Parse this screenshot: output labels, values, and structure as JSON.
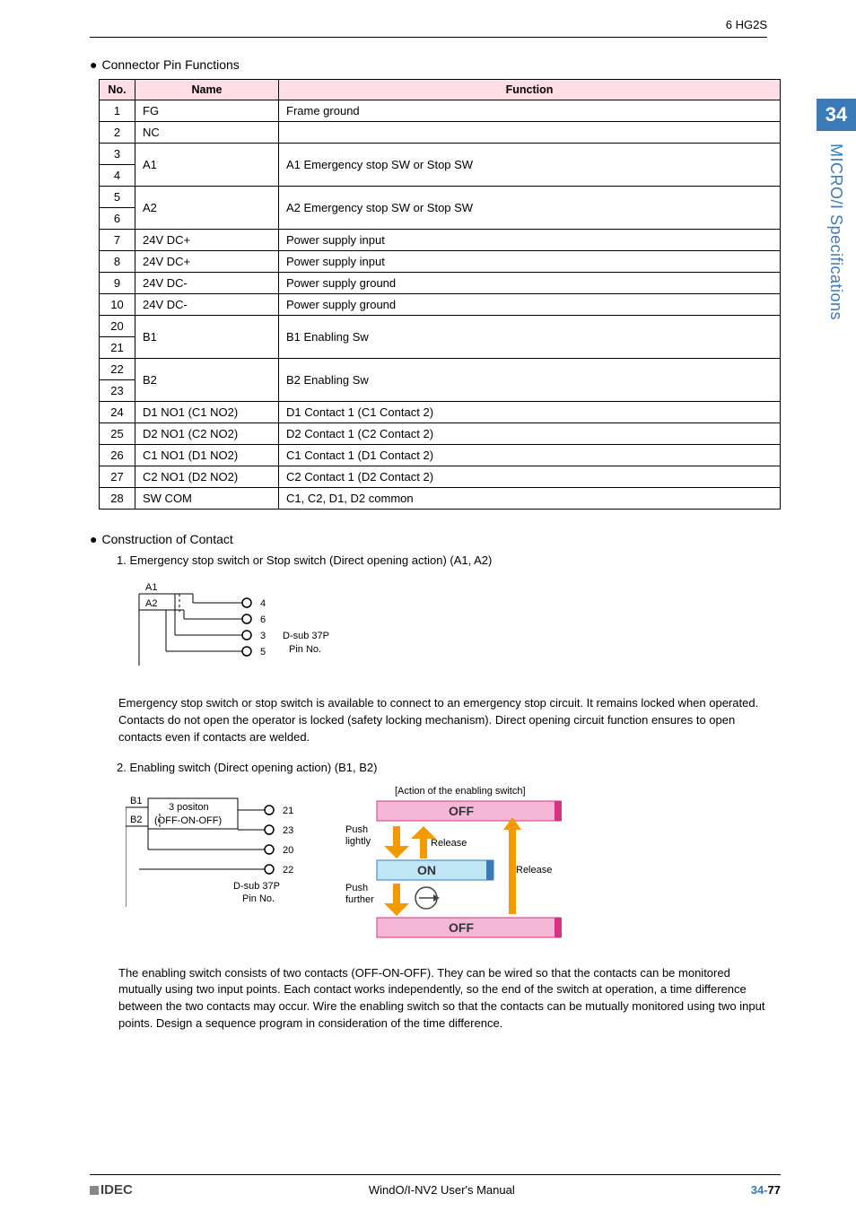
{
  "header": {
    "product": "6 HG2S"
  },
  "side": {
    "chapter": "34",
    "label": "MICRO/I Specifications"
  },
  "section1": {
    "title": "Connector Pin Functions",
    "columns": {
      "no": "No.",
      "name": "Name",
      "function": "Function"
    },
    "rows": [
      {
        "no": "1",
        "name": "FG",
        "fn": "Frame ground",
        "rs_name": 1,
        "rs_fn": 1
      },
      {
        "no": "2",
        "name": "NC",
        "fn": "",
        "rs_name": 1,
        "rs_fn": 1
      },
      {
        "no": "3",
        "name": "A1",
        "fn": "A1 Emergency stop SW or Stop SW",
        "rs_name": 2,
        "rs_fn": 2
      },
      {
        "no": "4"
      },
      {
        "no": "5",
        "name": "A2",
        "fn": "A2 Emergency stop SW or Stop SW",
        "rs_name": 2,
        "rs_fn": 2
      },
      {
        "no": "6"
      },
      {
        "no": "7",
        "name": "24V DC+",
        "fn": "Power supply input",
        "rs_name": 1,
        "rs_fn": 1
      },
      {
        "no": "8",
        "name": "24V DC+",
        "fn": "Power supply input",
        "rs_name": 1,
        "rs_fn": 1
      },
      {
        "no": "9",
        "name": "24V DC-",
        "fn": "Power supply ground",
        "rs_name": 1,
        "rs_fn": 1
      },
      {
        "no": "10",
        "name": "24V DC-",
        "fn": "Power supply ground",
        "rs_name": 1,
        "rs_fn": 1
      },
      {
        "no": "20",
        "name": "B1",
        "fn": "B1 Enabling Sw",
        "rs_name": 2,
        "rs_fn": 2
      },
      {
        "no": "21"
      },
      {
        "no": "22",
        "name": "B2",
        "fn": "B2 Enabling Sw",
        "rs_name": 2,
        "rs_fn": 2
      },
      {
        "no": "23"
      },
      {
        "no": "24",
        "name": "D1 NO1 (C1 NO2)",
        "fn": "D1 Contact 1 (C1 Contact 2)",
        "rs_name": 1,
        "rs_fn": 1
      },
      {
        "no": "25",
        "name": "D2 NO1 (C2 NO2)",
        "fn": "D2 Contact 1 (C2 Contact 2)",
        "rs_name": 1,
        "rs_fn": 1
      },
      {
        "no": "26",
        "name": "C1 NO1 (D1 NO2)",
        "fn": "C1 Contact 1 (D1 Contact 2)",
        "rs_name": 1,
        "rs_fn": 1
      },
      {
        "no": "27",
        "name": "C2 NO1 (D2 NO2)",
        "fn": "C2 Contact 1 (D2 Contact 2)",
        "rs_name": 1,
        "rs_fn": 1
      },
      {
        "no": "28",
        "name": "SW COM",
        "fn": "C1, C2, D1, D2 common",
        "rs_name": 1,
        "rs_fn": 1
      }
    ]
  },
  "section2": {
    "title": "Construction of Contact",
    "item1": {
      "heading": "1. Emergency stop switch or Stop switch (Direct opening action) (A1, A2)",
      "diagram": {
        "a1": "A1",
        "a2": "A2",
        "pins": [
          "4",
          "6",
          "3",
          "5"
        ],
        "label1": "D-sub 37P",
        "label2": "Pin No."
      },
      "body": "Emergency stop switch or stop switch is available to connect to an emergency stop circuit. It remains locked when operated. Contacts do not open the operator is locked (safety locking mechanism). Direct opening circuit function ensures to open contacts even if contacts are welded."
    },
    "item2": {
      "heading": "2. Enabling switch (Direct opening action) (B1, B2)",
      "diagram": {
        "b1": "B1",
        "b2": "B2",
        "pos": "3 positon",
        "mode": "(OFF-ON-OFF)",
        "pins": [
          "21",
          "23",
          "20",
          "22"
        ],
        "label1": "D-sub 37P",
        "label2": "Pin No.",
        "action_title": "[Action of the enabling switch]",
        "off": "OFF",
        "on": "ON",
        "push_lightly": "Push\nlightly",
        "release": "Release",
        "push_further": "Push\nfurther"
      },
      "body": "The enabling switch consists of two contacts (OFF-ON-OFF). They can be wired so that the contacts can be monitored mutually using two input points. Each contact works independently, so the end of the switch at operation, a time difference between the two contacts may occur. Wire the enabling switch so that the contacts can be mutually monitored using two input points. Design a sequence program in consideration of the time difference."
    }
  },
  "footer": {
    "brand": "IDEC",
    "manual": "WindO/I-NV2 User's Manual",
    "page_prefix": "34-",
    "page_num": "77"
  }
}
